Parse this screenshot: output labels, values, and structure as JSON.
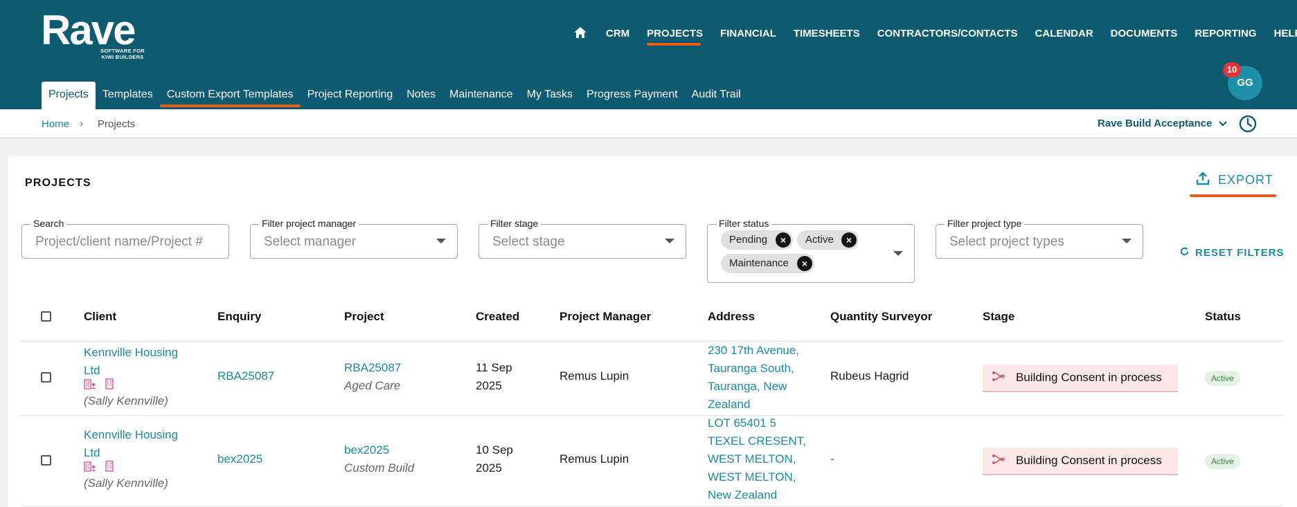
{
  "brand": {
    "name": "Rave",
    "tagline_1": "SOFTWARE FOR",
    "tagline_2": "KIWI BUILDERS"
  },
  "top_nav": {
    "home_icon": "home-icon",
    "items": [
      "CRM",
      "PROJECTS",
      "FINANCIAL",
      "TIMESHEETS",
      "CONTRACTORS/CONTACTS",
      "CALENDAR",
      "DOCUMENTS",
      "REPORTING",
      "HELP"
    ],
    "active": "PROJECTS"
  },
  "sub_nav": {
    "items": [
      "Projects",
      "Templates",
      "Custom Export Templates",
      "Project Reporting",
      "Notes",
      "Maintenance",
      "My Tasks",
      "Progress Payment",
      "Audit Trail"
    ],
    "active": "Projects",
    "highlighted": "Custom Export Templates"
  },
  "user": {
    "initials": "GG",
    "notification_count": "10"
  },
  "breadcrumb": {
    "home": "Home",
    "separator": "›",
    "current": "Projects"
  },
  "company": {
    "name": "Rave Build Acceptance"
  },
  "page": {
    "title": "PROJECTS",
    "export_label": "EXPORT",
    "reset_label": "RESET FILTERS"
  },
  "filters": {
    "search": {
      "label": "Search",
      "placeholder": "Project/client name/Project #"
    },
    "manager": {
      "label": "Filter project manager",
      "placeholder": "Select manager"
    },
    "stage": {
      "label": "Filter stage",
      "placeholder": "Select stage"
    },
    "status": {
      "label": "Filter status",
      "chips": [
        "Pending",
        "Active",
        "Maintenance"
      ]
    },
    "type": {
      "label": "Filter project type",
      "placeholder": "Select project types"
    }
  },
  "table": {
    "columns": [
      "Client",
      "Enquiry",
      "Project",
      "Created",
      "Project Manager",
      "Address",
      "Quantity Surveyor",
      "Stage",
      "Status"
    ],
    "rows": [
      {
        "client_line1": "Kennville Housing",
        "client_line2": "Ltd",
        "client_contact": "(Sally Kennville)",
        "enquiry": "RBA25087",
        "project": "RBA25087",
        "project_type": "Aged Care",
        "created_line1": "11 Sep",
        "created_line2": "2025",
        "manager": "Remus Lupin",
        "address": [
          "230 17th Avenue,",
          "Tauranga South,",
          "Tauranga, New",
          "Zealand"
        ],
        "surveyor": "Rubeus Hagrid",
        "stage": "Building Consent in process",
        "status": "Active"
      },
      {
        "client_line1": "Kennville Housing",
        "client_line2": "Ltd",
        "client_contact": "(Sally Kennville)",
        "enquiry": "bex2025",
        "project": "bex2025",
        "project_type": "Custom Build",
        "created_line1": "10 Sep",
        "created_line2": "2025",
        "manager": "Remus Lupin",
        "address": [
          "LOT 65401 5",
          "TEXEL CRESENT,",
          "WEST MELTON,",
          "WEST MELTON,",
          "New Zealand"
        ],
        "surveyor": "-",
        "stage": "Building Consent in process",
        "status": "Active"
      }
    ]
  },
  "colors": {
    "header": "#0e5a70",
    "accent": "#1d8aa5",
    "annotation": "#e95e14",
    "stage_bg": "#fde8ea",
    "status_bg": "#e5f1e6"
  }
}
